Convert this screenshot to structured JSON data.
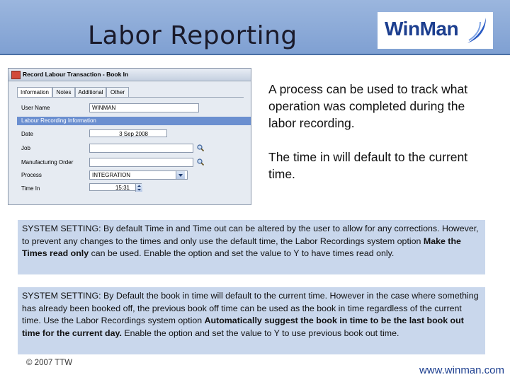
{
  "slide": {
    "title": "Labor Reporting",
    "logo_text": "WinMan",
    "description_1": "A process can be used to track what operation was completed during the labor recording.",
    "description_2": "The time in will default to the current time.",
    "box_1": {
      "prefix": "SYSTEM SETTING:   By default Time in and Time out can be altered by the user to allow for any corrections.  However, to prevent any changes to the times and only use the default time, the Labor Recordings system option ",
      "bold": "Make the Times read only",
      "suffix": " can be used.  Enable the option and set the value to Y to have times read only."
    },
    "box_2": {
      "prefix": "SYSTEM SETTING:   By Default the book in time will default to the current time.  However in the case where something has already been booked off, the previous book off time can be used as the book in time regardless of the current time.  Use the Labor Recordings system option ",
      "bold": "Automatically suggest the book in time to be the last book out time for the current day.",
      "suffix": "  Enable the option and set the value to Y to use previous book out time."
    },
    "copyright": "© 2007 TTW",
    "url": "www.winman.com"
  },
  "app": {
    "window_title": "Record Labour Transaction - Book In",
    "tabs": [
      "Information",
      "Notes",
      "Additional",
      "Other"
    ],
    "active_tab": "Information",
    "user_name_label": "User Name",
    "user_name_value": "WINMAN",
    "section_label": "Labour Recording Information",
    "date_label": "Date",
    "date_value": "3 Sep 2008",
    "job_label": "Job",
    "job_value": "",
    "manufacturing_order_label": "Manufacturing Order",
    "manufacturing_order_value": "",
    "process_label": "Process",
    "process_value": "INTEGRATION",
    "time_in_label": "Time In",
    "time_in_value": "15:31"
  },
  "colors": {
    "header": "#8aa9d8",
    "box_background": "#c9d7ec",
    "brand": "#1d3f8f",
    "section_bar": "#6b8fd0"
  }
}
